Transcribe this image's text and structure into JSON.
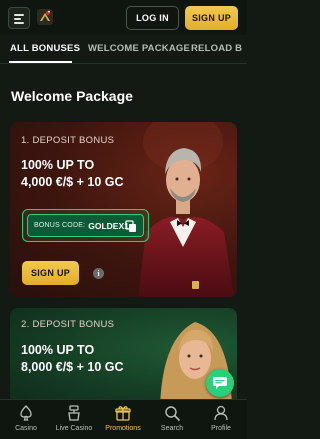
{
  "header": {
    "login_label": "LOG IN",
    "signup_label": "SIGN UP"
  },
  "tabs": [
    {
      "label": "ALL BONUSES",
      "active": true
    },
    {
      "label": "WELCOME PACKAGE",
      "active": false
    },
    {
      "label": "RELOAD B",
      "active": false
    }
  ],
  "section_title": "Welcome Package",
  "cards": [
    {
      "label": "1. DEPOSIT BONUS",
      "headline_line1": "100% UP TO",
      "headline_line2": "4,000 €/$ + 10 GC",
      "bonus_code_label": "BONUS CODE:",
      "bonus_code_value": "GOLDEX1",
      "signup_label": "SIGN UP",
      "info_glyph": "i"
    },
    {
      "label": "2. DEPOSIT BONUS",
      "headline_line1": "100% UP TO",
      "headline_line2": "8,000 €/$ + 10 GC"
    }
  ],
  "bottom_nav": [
    {
      "label": "Casino",
      "icon": "casino-icon",
      "active": false
    },
    {
      "label": "Live Casino",
      "icon": "live-casino-icon",
      "active": false
    },
    {
      "label": "Promotions",
      "icon": "gift-icon",
      "active": true
    },
    {
      "label": "Search",
      "icon": "search-icon",
      "active": false
    },
    {
      "label": "Profile",
      "icon": "profile-icon",
      "active": false
    }
  ],
  "colors": {
    "accent_gold": "#f0c64c",
    "accent_green": "#27d17a",
    "background": "#121a13"
  }
}
